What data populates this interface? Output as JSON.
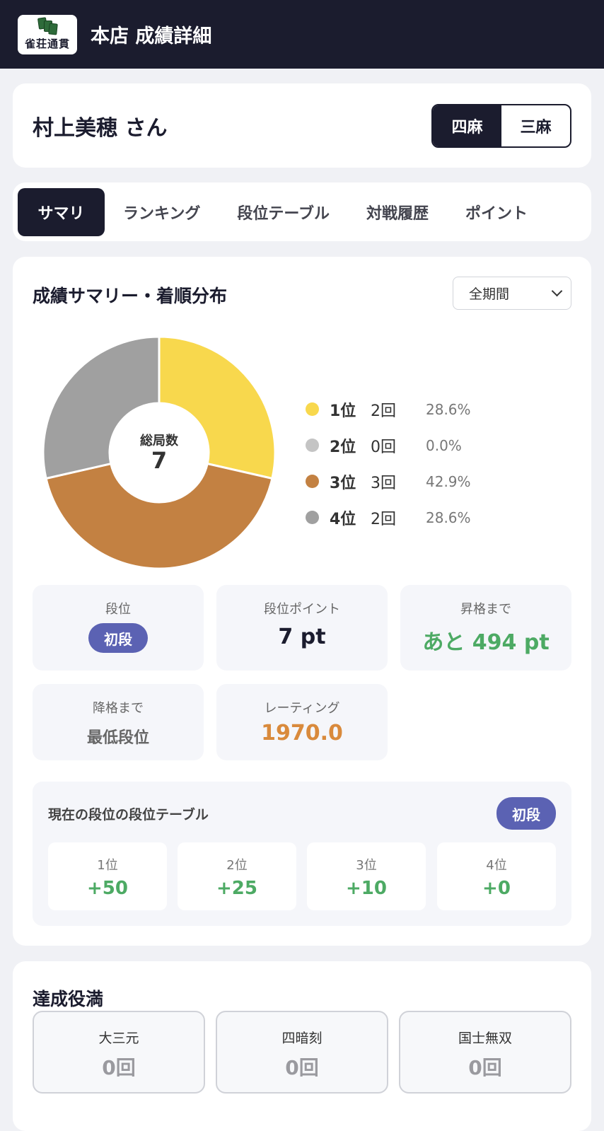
{
  "header": {
    "logo_text": "雀荘通貫",
    "title": "本店 成績詳細"
  },
  "user": {
    "name": "村上美穂 さん",
    "modes": [
      "四麻",
      "三麻"
    ],
    "selected_mode": "四麻"
  },
  "tabs": [
    "サマリ",
    "ランキング",
    "段位テーブル",
    "対戦履歴",
    "ポイント"
  ],
  "summary": {
    "title": "成績サマリー・着順分布",
    "period": "全期間",
    "center_label": "総局数",
    "center_value": "7"
  },
  "chart_data": {
    "type": "pie",
    "title": "",
    "total_label": "総局数",
    "total": 7,
    "categories": [
      "1位",
      "2位",
      "3位",
      "4位"
    ],
    "values": [
      2,
      0,
      3,
      2
    ],
    "percents": [
      28.6,
      0.0,
      42.9,
      28.6
    ],
    "colors": [
      "#f8d84d",
      "#c4c4c4",
      "#c38142",
      "#a0a0a0"
    ],
    "legend": [
      {
        "rank": "1位",
        "count": "2回",
        "pct": "28.6%"
      },
      {
        "rank": "2位",
        "count": "0回",
        "pct": "0.0%"
      },
      {
        "rank": "3位",
        "count": "3回",
        "pct": "42.9%"
      },
      {
        "rank": "4位",
        "count": "2回",
        "pct": "28.6%"
      }
    ],
    "legend_position": "right"
  },
  "stats": {
    "rank_label": "段位",
    "rank_value": "初段",
    "points_label": "段位ポイント",
    "points_value": "7 pt",
    "promote_label": "昇格まで",
    "promote_value": "あと 494 pt",
    "demote_label": "降格まで",
    "demote_value": "最低段位",
    "rating_label": "レーティング",
    "rating_value": "1970.0"
  },
  "rank_table": {
    "title": "現在の段位の段位テーブル",
    "badge": "初段",
    "cells": [
      {
        "place": "1位",
        "pts": "+50"
      },
      {
        "place": "2位",
        "pts": "+25"
      },
      {
        "place": "3位",
        "pts": "+10"
      },
      {
        "place": "4位",
        "pts": "+0"
      }
    ]
  },
  "yakuman": {
    "title": "達成役満",
    "items": [
      {
        "name": "大三元",
        "count": "0回"
      },
      {
        "name": "四暗刻",
        "count": "0回"
      },
      {
        "name": "国士無双",
        "count": "0回"
      }
    ]
  },
  "colors": {
    "navy": "#1b1c2e",
    "green": "#4daa64",
    "orange": "#d98a3c",
    "badge": "#5b62b3"
  }
}
